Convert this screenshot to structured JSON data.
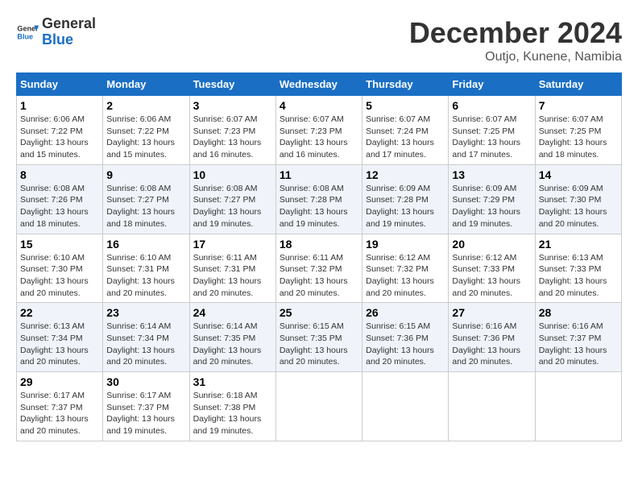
{
  "header": {
    "logo_line1": "General",
    "logo_line2": "Blue",
    "month": "December 2024",
    "location": "Outjo, Kunene, Namibia"
  },
  "weekdays": [
    "Sunday",
    "Monday",
    "Tuesday",
    "Wednesday",
    "Thursday",
    "Friday",
    "Saturday"
  ],
  "weeks": [
    [
      {
        "day": "1",
        "sunrise": "6:06 AM",
        "sunset": "7:22 PM",
        "daylight": "13 hours and 15 minutes."
      },
      {
        "day": "2",
        "sunrise": "6:06 AM",
        "sunset": "7:22 PM",
        "daylight": "13 hours and 15 minutes."
      },
      {
        "day": "3",
        "sunrise": "6:07 AM",
        "sunset": "7:23 PM",
        "daylight": "13 hours and 16 minutes."
      },
      {
        "day": "4",
        "sunrise": "6:07 AM",
        "sunset": "7:23 PM",
        "daylight": "13 hours and 16 minutes."
      },
      {
        "day": "5",
        "sunrise": "6:07 AM",
        "sunset": "7:24 PM",
        "daylight": "13 hours and 17 minutes."
      },
      {
        "day": "6",
        "sunrise": "6:07 AM",
        "sunset": "7:25 PM",
        "daylight": "13 hours and 17 minutes."
      },
      {
        "day": "7",
        "sunrise": "6:07 AM",
        "sunset": "7:25 PM",
        "daylight": "13 hours and 18 minutes."
      }
    ],
    [
      {
        "day": "8",
        "sunrise": "6:08 AM",
        "sunset": "7:26 PM",
        "daylight": "13 hours and 18 minutes."
      },
      {
        "day": "9",
        "sunrise": "6:08 AM",
        "sunset": "7:27 PM",
        "daylight": "13 hours and 18 minutes."
      },
      {
        "day": "10",
        "sunrise": "6:08 AM",
        "sunset": "7:27 PM",
        "daylight": "13 hours and 19 minutes."
      },
      {
        "day": "11",
        "sunrise": "6:08 AM",
        "sunset": "7:28 PM",
        "daylight": "13 hours and 19 minutes."
      },
      {
        "day": "12",
        "sunrise": "6:09 AM",
        "sunset": "7:28 PM",
        "daylight": "13 hours and 19 minutes."
      },
      {
        "day": "13",
        "sunrise": "6:09 AM",
        "sunset": "7:29 PM",
        "daylight": "13 hours and 19 minutes."
      },
      {
        "day": "14",
        "sunrise": "6:09 AM",
        "sunset": "7:30 PM",
        "daylight": "13 hours and 20 minutes."
      }
    ],
    [
      {
        "day": "15",
        "sunrise": "6:10 AM",
        "sunset": "7:30 PM",
        "daylight": "13 hours and 20 minutes."
      },
      {
        "day": "16",
        "sunrise": "6:10 AM",
        "sunset": "7:31 PM",
        "daylight": "13 hours and 20 minutes."
      },
      {
        "day": "17",
        "sunrise": "6:11 AM",
        "sunset": "7:31 PM",
        "daylight": "13 hours and 20 minutes."
      },
      {
        "day": "18",
        "sunrise": "6:11 AM",
        "sunset": "7:32 PM",
        "daylight": "13 hours and 20 minutes."
      },
      {
        "day": "19",
        "sunrise": "6:12 AM",
        "sunset": "7:32 PM",
        "daylight": "13 hours and 20 minutes."
      },
      {
        "day": "20",
        "sunrise": "6:12 AM",
        "sunset": "7:33 PM",
        "daylight": "13 hours and 20 minutes."
      },
      {
        "day": "21",
        "sunrise": "6:13 AM",
        "sunset": "7:33 PM",
        "daylight": "13 hours and 20 minutes."
      }
    ],
    [
      {
        "day": "22",
        "sunrise": "6:13 AM",
        "sunset": "7:34 PM",
        "daylight": "13 hours and 20 minutes."
      },
      {
        "day": "23",
        "sunrise": "6:14 AM",
        "sunset": "7:34 PM",
        "daylight": "13 hours and 20 minutes."
      },
      {
        "day": "24",
        "sunrise": "6:14 AM",
        "sunset": "7:35 PM",
        "daylight": "13 hours and 20 minutes."
      },
      {
        "day": "25",
        "sunrise": "6:15 AM",
        "sunset": "7:35 PM",
        "daylight": "13 hours and 20 minutes."
      },
      {
        "day": "26",
        "sunrise": "6:15 AM",
        "sunset": "7:36 PM",
        "daylight": "13 hours and 20 minutes."
      },
      {
        "day": "27",
        "sunrise": "6:16 AM",
        "sunset": "7:36 PM",
        "daylight": "13 hours and 20 minutes."
      },
      {
        "day": "28",
        "sunrise": "6:16 AM",
        "sunset": "7:37 PM",
        "daylight": "13 hours and 20 minutes."
      }
    ],
    [
      {
        "day": "29",
        "sunrise": "6:17 AM",
        "sunset": "7:37 PM",
        "daylight": "13 hours and 20 minutes."
      },
      {
        "day": "30",
        "sunrise": "6:17 AM",
        "sunset": "7:37 PM",
        "daylight": "13 hours and 19 minutes."
      },
      {
        "day": "31",
        "sunrise": "6:18 AM",
        "sunset": "7:38 PM",
        "daylight": "13 hours and 19 minutes."
      },
      null,
      null,
      null,
      null
    ]
  ],
  "labels": {
    "sunrise": "Sunrise:",
    "sunset": "Sunset:",
    "daylight": "Daylight:"
  }
}
